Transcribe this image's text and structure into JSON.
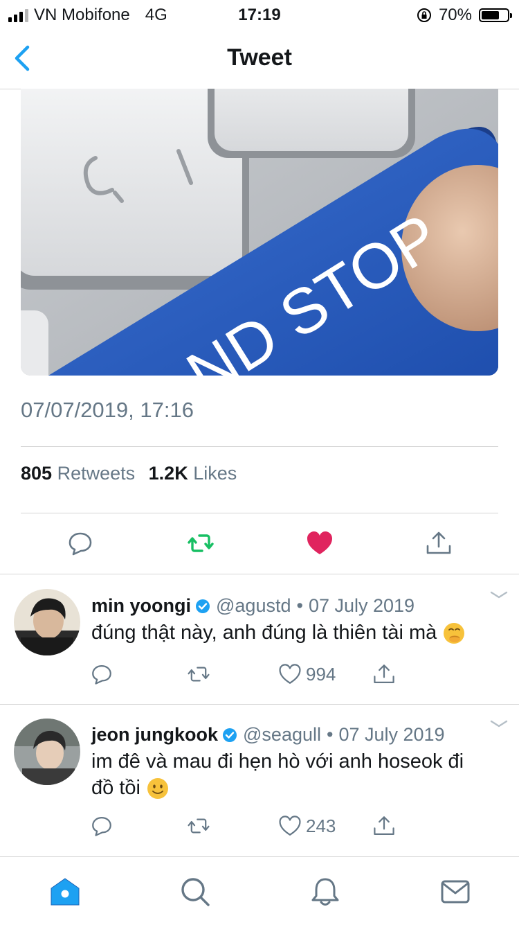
{
  "status_bar": {
    "carrier": "VN Mobifone",
    "network": "4G",
    "time": "17:19",
    "battery": "70%",
    "battery_level": 0.7
  },
  "nav": {
    "title": "Tweet",
    "back_icon": "chevron-left-icon"
  },
  "media": {
    "key_label": "ND STOP"
  },
  "tweet": {
    "timestamp": "07/07/2019, 17:16",
    "retweets_count": "805",
    "retweets_label": "Retweets",
    "likes_count": "1.2K",
    "likes_label": "Likes",
    "liked": true,
    "colors": {
      "retweet": "#17bf63",
      "like": "#e0245e",
      "icon": "#657786",
      "accent": "#1da1f2"
    }
  },
  "replies": [
    {
      "name": "min yoongi",
      "handle": "@agustd",
      "separator": "•",
      "date": "07 July 2019",
      "text": "đúng thật này, anh đúng là thiên tài mà",
      "emoji": "face-with-hand-over-mouth",
      "likes": "994",
      "verified": true
    },
    {
      "name": "jeon jungkook",
      "handle": "@seagull",
      "separator": "•",
      "date": "07 July 2019",
      "text_line1": "im đê và mau đi hẹn hò với anh hoseok đi",
      "text_line2": "đồ tồi",
      "emoji": "slightly-smiling-face",
      "likes": "243",
      "verified": true
    }
  ],
  "tab_bar": {
    "items": [
      "home-icon",
      "search-icon",
      "notifications-icon",
      "messages-icon"
    ],
    "active": "home-icon"
  }
}
